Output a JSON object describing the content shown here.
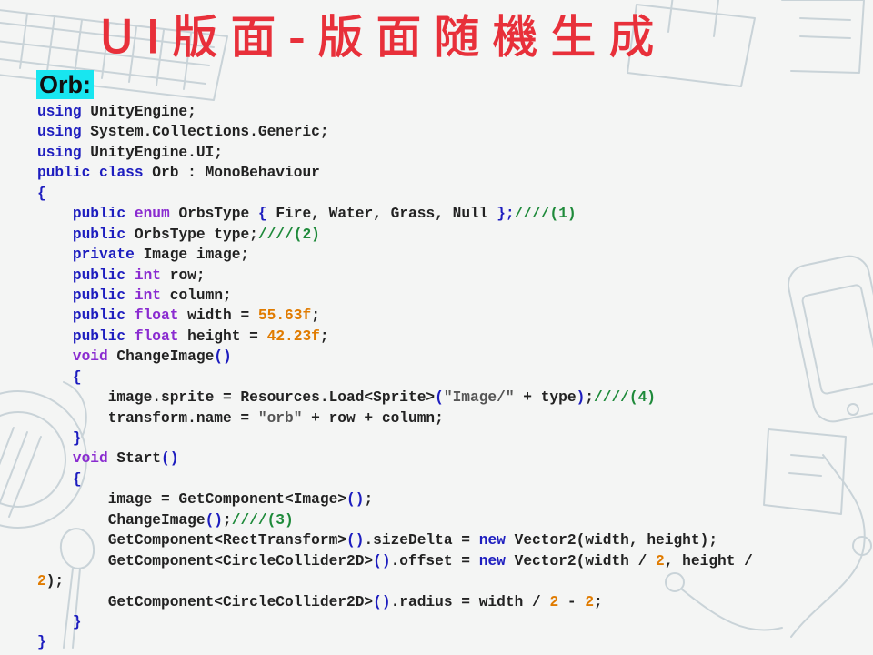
{
  "slide": {
    "title": "UI版面-版面随機生成",
    "subtitle": "Orb:"
  },
  "code_lines": [
    [
      [
        "kw",
        "using"
      ],
      [
        "pn",
        " UnityEngine;"
      ]
    ],
    [
      [
        "kw",
        "using"
      ],
      [
        "pn",
        " System.Collections.Generic;"
      ]
    ],
    [
      [
        "kw",
        "using"
      ],
      [
        "pn",
        " UnityEngine.UI;"
      ]
    ],
    [
      [
        "kw",
        "public"
      ],
      [
        "pn",
        " "
      ],
      [
        "kw",
        "class"
      ],
      [
        "pn",
        " Orb : MonoBehaviour"
      ]
    ],
    [
      [
        "kw",
        "{"
      ]
    ],
    [
      [
        "pn",
        "    "
      ],
      [
        "kw",
        "public"
      ],
      [
        "pn",
        " "
      ],
      [
        "ty",
        "enum"
      ],
      [
        "pn",
        " OrbsType "
      ],
      [
        "kw",
        "{"
      ],
      [
        "pn",
        " Fire, Water, Grass, Null "
      ],
      [
        "kw",
        "};"
      ],
      [
        "cm",
        "////(1)"
      ]
    ],
    [
      [
        "pn",
        "    "
      ],
      [
        "kw",
        "public"
      ],
      [
        "pn",
        " OrbsType type;"
      ],
      [
        "cm",
        "////(2)"
      ]
    ],
    [
      [
        "pn",
        "    "
      ],
      [
        "kw",
        "private"
      ],
      [
        "pn",
        " Image image;"
      ]
    ],
    [
      [
        "pn",
        "    "
      ],
      [
        "kw",
        "public"
      ],
      [
        "pn",
        " "
      ],
      [
        "ty",
        "int"
      ],
      [
        "pn",
        " row;"
      ]
    ],
    [
      [
        "pn",
        "    "
      ],
      [
        "kw",
        "public"
      ],
      [
        "pn",
        " "
      ],
      [
        "ty",
        "int"
      ],
      [
        "pn",
        " column;"
      ]
    ],
    [
      [
        "pn",
        "    "
      ],
      [
        "kw",
        "public"
      ],
      [
        "pn",
        " "
      ],
      [
        "ty",
        "float"
      ],
      [
        "pn",
        " width = "
      ],
      [
        "num",
        "55.63f"
      ],
      [
        "pn",
        ";"
      ]
    ],
    [
      [
        "pn",
        "    "
      ],
      [
        "kw",
        "public"
      ],
      [
        "pn",
        " "
      ],
      [
        "ty",
        "float"
      ],
      [
        "pn",
        " height = "
      ],
      [
        "num",
        "42.23f"
      ],
      [
        "pn",
        ";"
      ]
    ],
    [
      [
        "pn",
        "    "
      ],
      [
        "ty",
        "void"
      ],
      [
        "pn",
        " ChangeImage"
      ],
      [
        "kw",
        "()"
      ]
    ],
    [
      [
        "pn",
        "    "
      ],
      [
        "kw",
        "{"
      ]
    ],
    [
      [
        "pn",
        "        image.sprite = Resources.Load<Sprite>"
      ],
      [
        "kw",
        "("
      ],
      [
        "str",
        "\"Image/\""
      ],
      [
        "pn",
        " + type"
      ],
      [
        "kw",
        ")"
      ],
      [
        "pn",
        ";"
      ],
      [
        "cm",
        "////(4)"
      ]
    ],
    [
      [
        "pn",
        "        transform.name = "
      ],
      [
        "str",
        "\"orb\""
      ],
      [
        "pn",
        " + row + column;"
      ]
    ],
    [
      [
        "pn",
        "    "
      ],
      [
        "kw",
        "}"
      ]
    ],
    [
      [
        "pn",
        "    "
      ],
      [
        "ty",
        "void"
      ],
      [
        "pn",
        " Start"
      ],
      [
        "kw",
        "()"
      ]
    ],
    [
      [
        "pn",
        "    "
      ],
      [
        "kw",
        "{"
      ]
    ],
    [
      [
        "pn",
        "        image = GetComponent<Image>"
      ],
      [
        "kw",
        "()"
      ],
      [
        "pn",
        ";"
      ]
    ],
    [
      [
        "pn",
        "        ChangeImage"
      ],
      [
        "kw",
        "()"
      ],
      [
        "pn",
        ";"
      ],
      [
        "cm",
        "////(3)"
      ]
    ],
    [
      [
        "pn",
        "        GetComponent<RectTransform>"
      ],
      [
        "kw",
        "()"
      ],
      [
        "pn",
        ".sizeDelta = "
      ],
      [
        "kw",
        "new"
      ],
      [
        "pn",
        " Vector2(width, height);"
      ]
    ],
    [
      [
        "pn",
        "        GetComponent<CircleCollider2D>"
      ],
      [
        "kw",
        "()"
      ],
      [
        "pn",
        ".offset = "
      ],
      [
        "kw",
        "new"
      ],
      [
        "pn",
        " Vector2(width / "
      ],
      [
        "num",
        "2"
      ],
      [
        "pn",
        ", height /"
      ]
    ],
    [
      [
        "num",
        "2"
      ],
      [
        "pn",
        ");"
      ]
    ],
    [
      [
        "pn",
        "        GetComponent<CircleCollider2D>"
      ],
      [
        "kw",
        "()"
      ],
      [
        "pn",
        ".radius = width / "
      ],
      [
        "num",
        "2"
      ],
      [
        "pn",
        " - "
      ],
      [
        "num",
        "2"
      ],
      [
        "pn",
        ";"
      ]
    ],
    [
      [
        "pn",
        "    "
      ],
      [
        "kw",
        "}"
      ]
    ],
    [
      [
        "kw",
        "}"
      ]
    ]
  ],
  "colors": {
    "title": "#e8303a",
    "subtitle_highlight": "#18e6f0",
    "keyword": "#1d1dbf",
    "type": "#8a2bd0",
    "number": "#e07b00",
    "comment": "#1e8a3a"
  },
  "decor": [
    "keyboard-doodle",
    "notebook-doodle",
    "phone-doodle",
    "coffee-cup-doodle",
    "spoon-doodle",
    "earphones-doodle",
    "sticky-note-doodle"
  ]
}
